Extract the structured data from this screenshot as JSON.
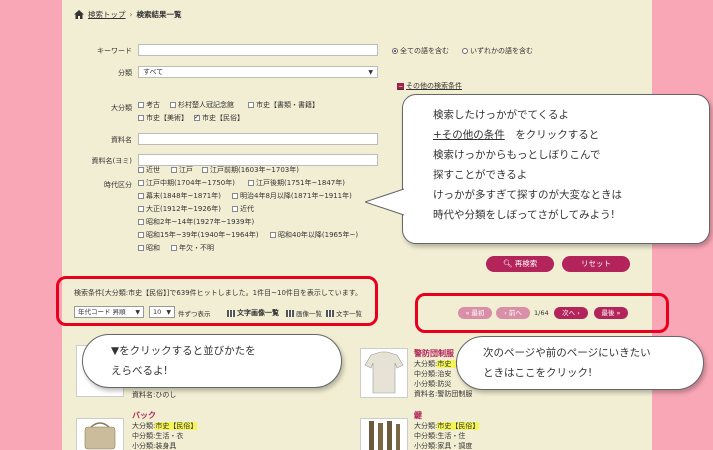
{
  "breadcrumb": {
    "home": "検索トップ",
    "sep": "›",
    "current": "検索結果一覧"
  },
  "form": {
    "keyword_label": "キーワード",
    "radio_all": "全ての語を含む",
    "radio_any": "いずれかの語を含む",
    "category_label": "分類",
    "category_value": "すべて",
    "other_conditions": "その他の検索条件",
    "daibunrui_label": "大分類",
    "daibunrui": [
      {
        "label": "考古",
        "checked": false
      },
      {
        "label": "杉村楚人冠記念館",
        "checked": false
      },
      {
        "label": "市史【書類・書籍】",
        "checked": false
      },
      {
        "label": "市史【美術】",
        "checked": false
      },
      {
        "label": "市史【民俗】",
        "checked": true
      }
    ],
    "shiryomei_label": "資料名",
    "yomi_label": "資料名(ヨミ)",
    "era_label": "時代区分",
    "eras": [
      "近世",
      "江戸",
      "江戸前期(1603年~1703年)",
      "江戸中期(1704年~1750年)",
      "江戸後期(1751年~1847年)",
      "幕末(1848年~1871年)",
      "明治4年8月以降(1871年~1911年)",
      "大正(1912年~1926年)",
      "近代",
      "昭和2年~14年(1927年~1939年)",
      "昭和15年~39年(1940年~1964年)",
      "昭和40年以降(1965年~)",
      "昭和",
      "年欠・不明"
    ],
    "search_button": "再検索",
    "reset_button": "リセット"
  },
  "results": {
    "condition": "検索条件[大分類:市史【民俗】]で639件ヒットしました。1件目~10件目を表示しています。",
    "sort_value": "年代コード 昇順",
    "per_page_value": "10",
    "per_page_suffix": "件ずつ表示",
    "view_text_image": "文字画像一覧",
    "view_image": "画像一覧",
    "view_text": "文字一覧",
    "pager": {
      "first": "« 最初",
      "prev": "‹ 前へ",
      "page": "1/64",
      "next": "次へ ›",
      "last": "最後 »"
    },
    "items": [
      {
        "name_line": "資料名:ひのし"
      },
      {
        "title": "警防団制服",
        "lines": [
          "大分類:市史【民俗】",
          "中分類:治安",
          "小分類:防災",
          "資料名:警防団制服"
        ]
      },
      {
        "title": "バック",
        "lines": [
          "大分類:市史【民俗】",
          "中分類:生活・衣",
          "小分類:装身具"
        ]
      },
      {
        "title": "鍵",
        "lines": [
          "大分類:市史【民俗】",
          "中分類:生活・住",
          "小分類:家具・調度"
        ]
      }
    ]
  },
  "bubbles": {
    "main": [
      "検索したけっかがでてくるよ",
      "+その他の条件",
      "をクリックすると",
      "検索けっかからもっとしぼりこんで",
      "探すことができるよ",
      "けっかが多すぎて探すのが大変なときは",
      "時代や分類をしぼってさがしてみよう!"
    ],
    "sort": [
      "▼をクリックすると並びかたを",
      "えらべるよ!"
    ],
    "page": [
      "次のページや前のページにいきたい",
      "ときはここをクリック!"
    ]
  },
  "colors": {
    "background": "#f9a7b6",
    "panel": "#f2eed3",
    "accent": "#b3245a",
    "highlight_box": "#e8001c"
  }
}
